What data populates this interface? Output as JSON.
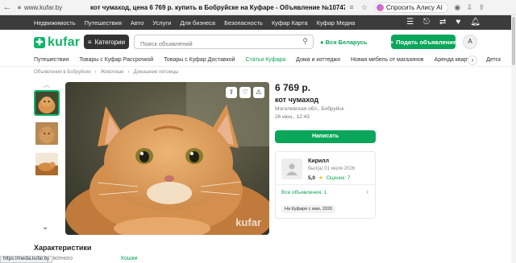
{
  "browser": {
    "url": "www.kufar.by",
    "title": "кот чумаход, цена 6 769 р. купить в Бобруйске на Куфаре - Объявление №1074717363",
    "assistant_label": "Спросить Алису AI"
  },
  "topnav": {
    "links": [
      "Недвижимость",
      "Путешествия",
      "Авто",
      "Услуги",
      "Для бизнеса",
      "Безопасность",
      "Куфар Карта",
      "Куфар Медиа"
    ]
  },
  "header": {
    "logo_text": "kufar",
    "categories_label": "Категории",
    "search_placeholder": "Поиск объявлений",
    "region_label": "Вся Беларусь",
    "post_button_label": "Подать объявление",
    "avatar_letter": "А"
  },
  "catbar": {
    "items": [
      {
        "label": "Путешествия",
        "highlight": false
      },
      {
        "label": "Товары с Куфар Рассрочкой",
        "highlight": false
      },
      {
        "label": "Товары с Куфар Доставкой",
        "highlight": false
      },
      {
        "label": "Статьи Куфара",
        "highlight": true
      },
      {
        "label": "Дома и коттеджи",
        "highlight": false
      },
      {
        "label": "Новая мебель от магазинов",
        "highlight": false
      },
      {
        "label": "Аренда квартир",
        "highlight": false
      },
      {
        "label": "Детск",
        "highlight": false
      }
    ]
  },
  "breadcrumbs": [
    "Объявления в Бобруйске",
    "Животные",
    "Домашние питомцы"
  ],
  "listing": {
    "price": "6 769 р.",
    "title": "кот чумаход",
    "location": "Могилевская обл., Бобруйск",
    "date": "26 июн., 12:43",
    "write_button": "Написать",
    "watermark": "kufar"
  },
  "seller": {
    "name": "Кирилл",
    "last_seen": "был(а) 01 июля 2026",
    "rating": "5,0",
    "reviews": "Оценок: 7",
    "all_ads": "Все объявления: 1",
    "since": "На Куфаре с мая, 2020"
  },
  "characteristics": {
    "heading": "Характеристики",
    "key": "Животного",
    "value": "Кошки"
  },
  "statusbar": {
    "text": "https://media.kufar.by"
  },
  "colors": {
    "brand_green": "#10b567",
    "button_green": "#0aa65a",
    "dark_nav": "#3c3c3c"
  }
}
